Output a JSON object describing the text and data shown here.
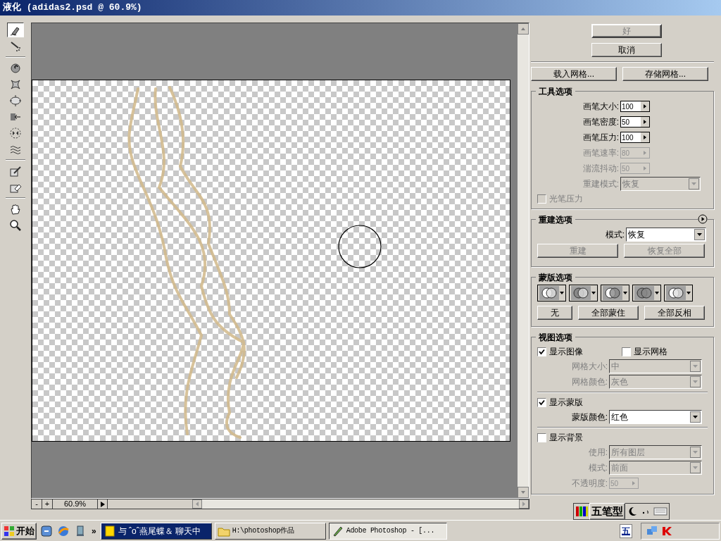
{
  "window": {
    "title": "液化 (adidas2.psd @ 60.9%)"
  },
  "tools": [
    {
      "kind": "warp",
      "selected": true
    },
    {
      "kind": "reconstruct",
      "selected": false
    },
    {
      "kind": "twirl",
      "selected": false
    },
    {
      "kind": "pucker",
      "selected": false
    },
    {
      "kind": "bloat",
      "selected": false
    },
    {
      "kind": "shift",
      "selected": false
    },
    {
      "kind": "reflect",
      "selected": false
    },
    {
      "kind": "turbulence",
      "selected": false
    },
    {
      "kind": "freeze",
      "selected": false
    },
    {
      "kind": "thaw",
      "selected": false
    },
    {
      "kind": "hand",
      "selected": false
    },
    {
      "kind": "zoom",
      "selected": false
    }
  ],
  "dialog_buttons": [
    {
      "label": "好",
      "disabled": true
    },
    {
      "label": "取消",
      "disabled": false
    }
  ],
  "mesh_buttons": [
    "载入网格...",
    "存储网格..."
  ],
  "tool_options": {
    "title": "工具选项",
    "fields": [
      {
        "label": "画笔大小:",
        "value": "100",
        "disabled": false
      },
      {
        "label": "画笔密度:",
        "value": "50",
        "disabled": false
      },
      {
        "label": "画笔压力:",
        "value": "100",
        "disabled": false
      },
      {
        "label": "画笔速率:",
        "value": "80",
        "disabled": true
      },
      {
        "label": "湍流抖动:",
        "value": "50",
        "disabled": true
      }
    ],
    "rebuild_mode": {
      "label": "重建模式:",
      "value": "恢复",
      "disabled": true
    },
    "stylus": {
      "label": "光笔压力",
      "checked": false,
      "disabled": true
    }
  },
  "rebuild_options": {
    "title": "重建选项",
    "mode": {
      "label": "模式:",
      "value": "恢复",
      "disabled": false
    },
    "buttons": [
      {
        "label": "重建",
        "disabled": true
      },
      {
        "label": "恢复全部",
        "disabled": true
      }
    ]
  },
  "mask_options": {
    "title": "蒙版选项",
    "modes": [
      {
        "kind": "replace"
      },
      {
        "kind": "add"
      },
      {
        "kind": "subtract"
      },
      {
        "kind": "intersect"
      },
      {
        "kind": "invert"
      }
    ],
    "buttons": [
      "无",
      "全部蒙住",
      "全部反相"
    ]
  },
  "view_options": {
    "title": "视图选项",
    "show_image": {
      "label": "显示图像",
      "checked": true
    },
    "show_mesh": {
      "label": "显示网格",
      "checked": false
    },
    "mesh_size": {
      "label": "网格大小:",
      "value": "中",
      "disabled": true
    },
    "mesh_color": {
      "label": "网格颜色:",
      "value": "灰色",
      "disabled": true
    },
    "show_mask": {
      "label": "显示蒙版",
      "checked": true
    },
    "mask_color": {
      "label": "蒙版颜色:",
      "value": "红色",
      "disabled": false
    },
    "show_backdrop": {
      "label": "显示背景",
      "checked": false
    },
    "use": {
      "label": "使用:",
      "value": "所有图层",
      "disabled": true
    },
    "mode": {
      "label": "模式:",
      "value": "前面",
      "disabled": true
    },
    "opacity": {
      "label": "不透明度:",
      "value": "50",
      "disabled": true
    }
  },
  "zoom_bar": {
    "minus": "-",
    "plus": "+",
    "value": "60.9%"
  },
  "ime_bar": {
    "label": "五笔型"
  },
  "taskbar": {
    "start": "开始",
    "more": "»",
    "tasks": [
      {
        "label": "与 ˆoˆ燕尾蝶＆ 聊天中",
        "kind": "chat",
        "flashing": true,
        "selected": false
      },
      {
        "label": "H:\\photoshop作品",
        "kind": "folder",
        "flashing": false,
        "selected": false
      },
      {
        "label": "Adobe Photoshop - [...",
        "kind": "photoshop",
        "flashing": false,
        "selected": true
      }
    ],
    "tray_ime": "五"
  }
}
